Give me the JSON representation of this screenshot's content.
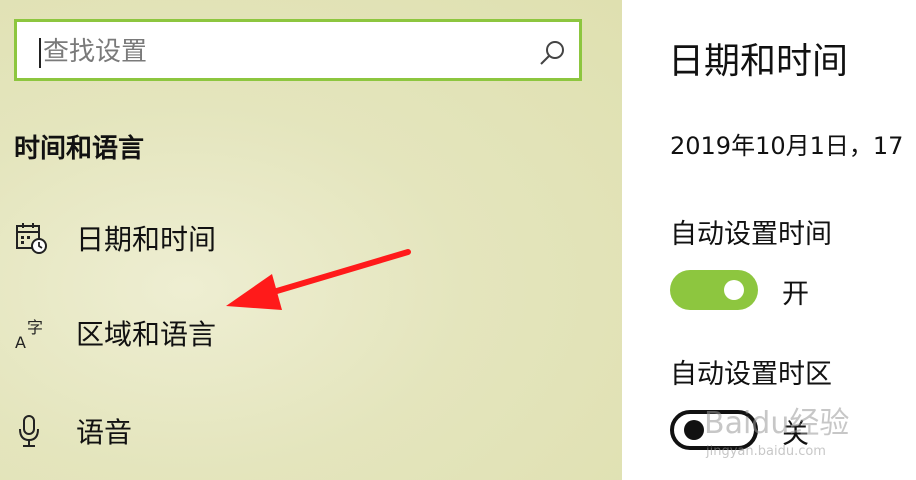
{
  "search": {
    "placeholder": "查找设置"
  },
  "sidebar": {
    "section_title": "时间和语言",
    "items": [
      {
        "label": "日期和时间",
        "icon": "calendar-clock-icon"
      },
      {
        "label": "区域和语言",
        "icon": "language-icon"
      },
      {
        "label": "语音",
        "icon": "microphone-icon"
      }
    ]
  },
  "main": {
    "title": "日期和时间",
    "current_datetime": "2019年10月1日，17",
    "auto_time": {
      "label": "自动设置时间",
      "state": "开",
      "on": true
    },
    "auto_timezone": {
      "label": "自动设置时区",
      "state": "关",
      "on": false
    }
  },
  "watermark": {
    "text": "Baidu经验",
    "subtext": "jingyan.baidu.com"
  },
  "colors": {
    "accent": "#8dc63f",
    "arrow": "#ff1a1a"
  }
}
